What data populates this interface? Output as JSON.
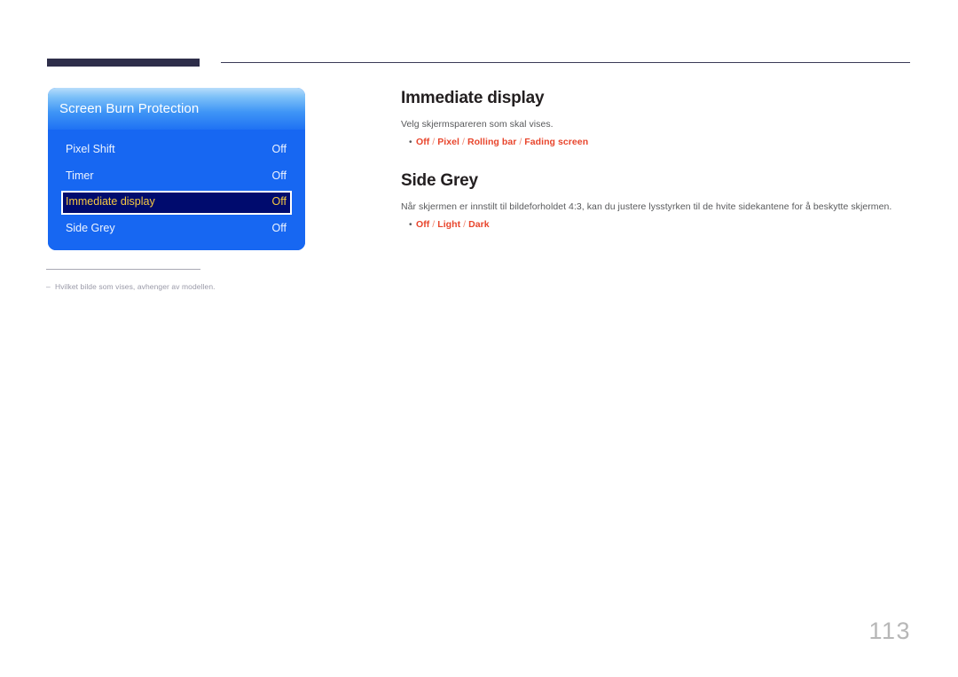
{
  "page": {
    "number": "113",
    "language": "no"
  },
  "osd": {
    "title": "Screen Burn Protection",
    "rows": [
      {
        "label": "Pixel Shift",
        "value": "Off",
        "selected": false
      },
      {
        "label": "Timer",
        "value": "Off",
        "selected": false
      },
      {
        "label": "Immediate display",
        "value": "Off",
        "selected": true
      },
      {
        "label": "Side Grey",
        "value": "Off",
        "selected": false
      }
    ],
    "colors": {
      "body": "#1767f2",
      "header_top": "#b8ddfb",
      "header_bottom": "#1f72f3",
      "selected_bg": "#000b6e",
      "selected_text": "#f5c842",
      "selected_border": "#ffffff"
    }
  },
  "footnote": {
    "dash": "–",
    "text": "Hvilket bilde som vises, avhenger av modellen."
  },
  "content": {
    "sections": [
      {
        "heading": "Immediate display",
        "description": "Velg skjermspareren som skal vises.",
        "bullet_dot": "•",
        "options": [
          {
            "text": "Off"
          },
          {
            "text": "Pixel"
          },
          {
            "text": "Rolling bar"
          },
          {
            "text": "Fading screen"
          }
        ],
        "separator": " / "
      },
      {
        "heading": "Side Grey",
        "description": "Når skjermen er innstilt til bildeforholdet 4:3, kan du justere lysstyrken til de hvite sidekantene for å beskytte skjermen.",
        "bullet_dot": "•",
        "options": [
          {
            "text": "Off"
          },
          {
            "text": "Light"
          },
          {
            "text": "Dark"
          }
        ],
        "separator": " / "
      }
    ]
  },
  "decor": {
    "bar_color": "#2e2e4a",
    "line_color": "#3b3b57"
  }
}
